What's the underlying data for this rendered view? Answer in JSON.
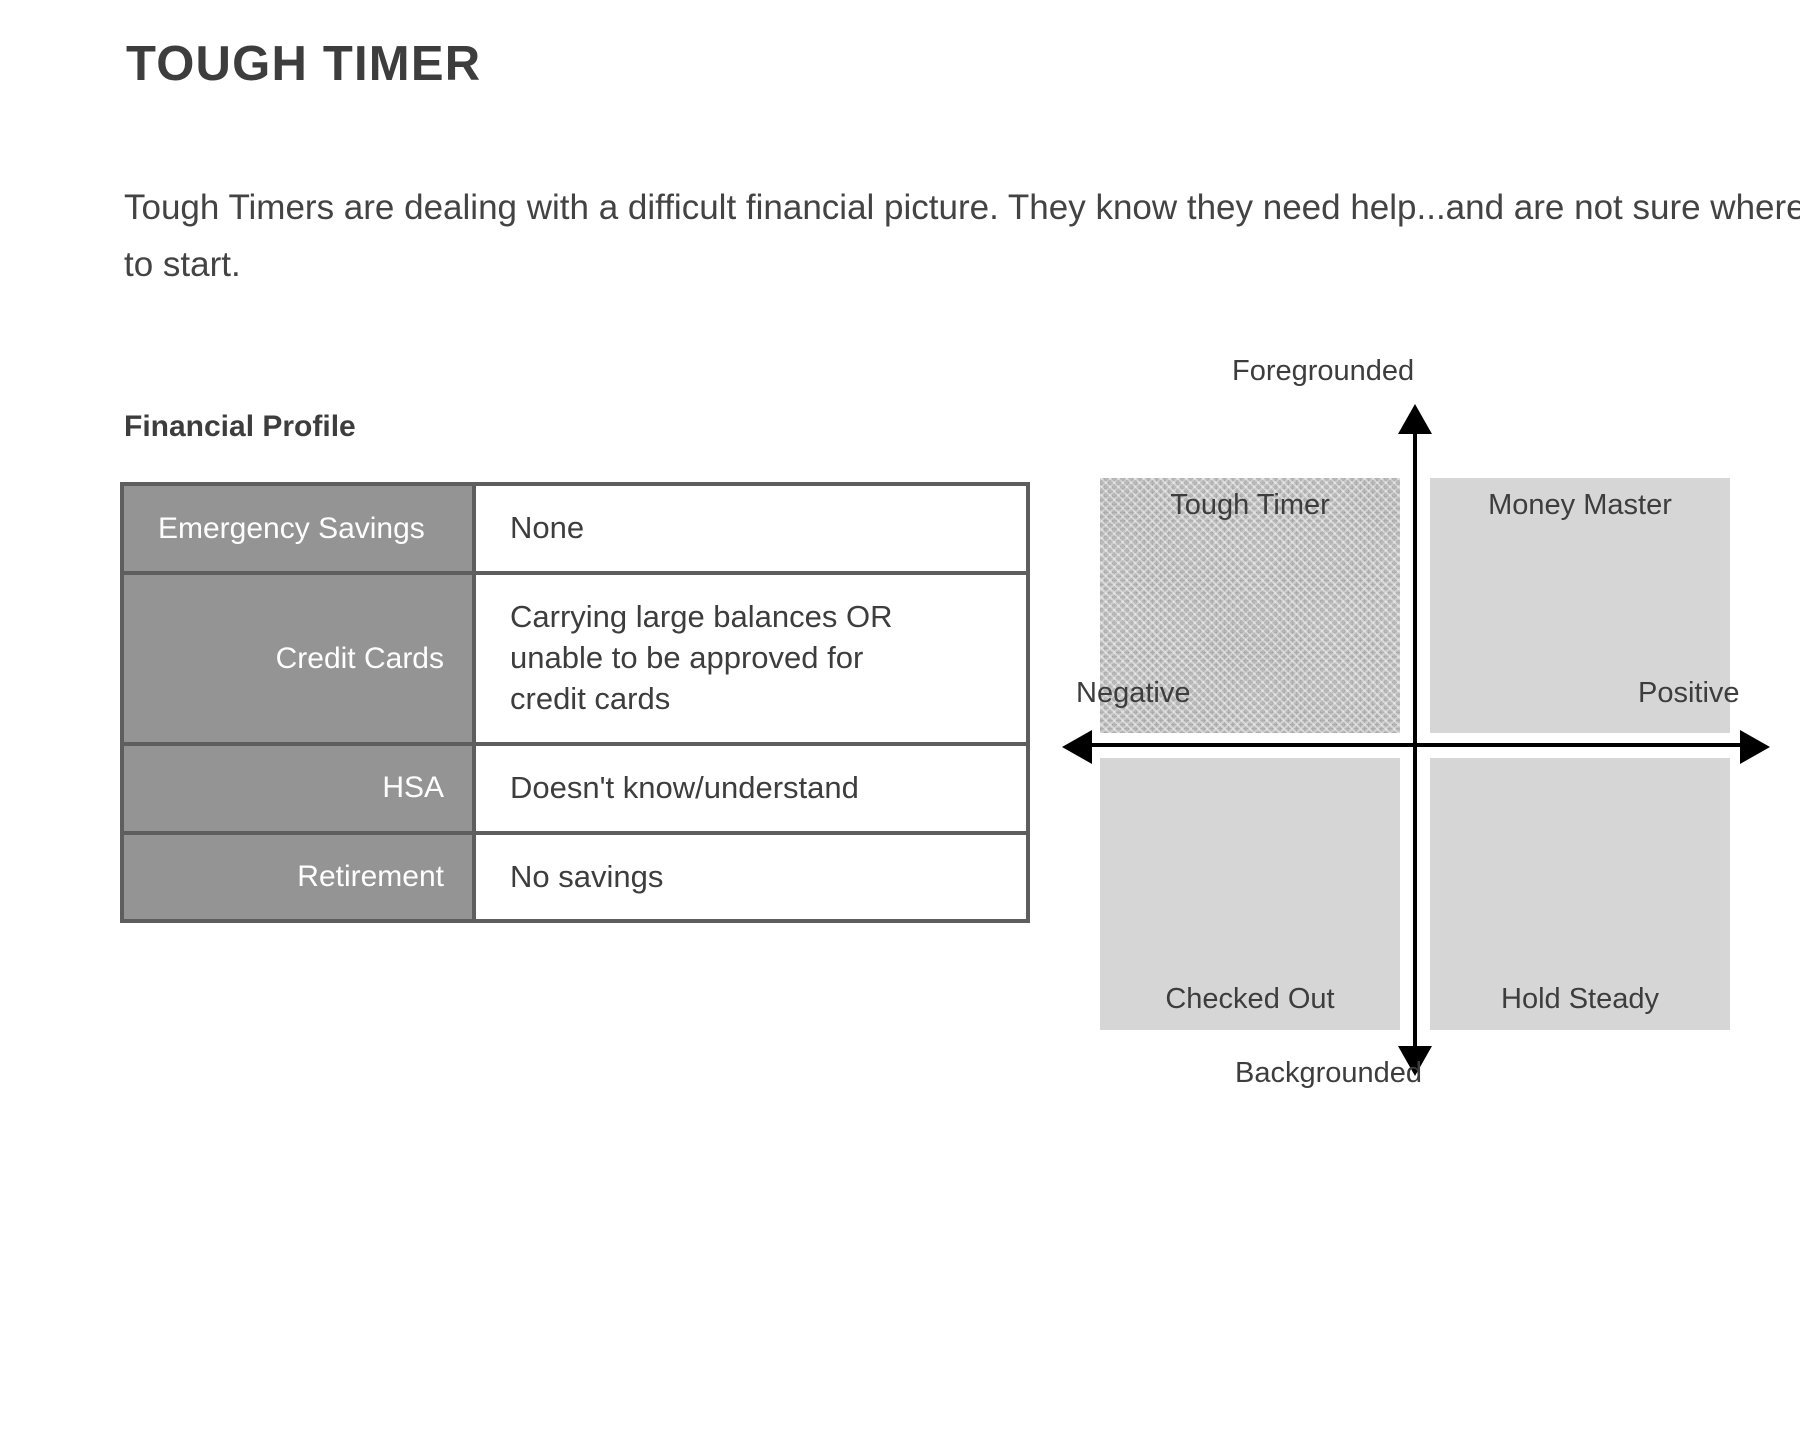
{
  "page": {
    "title": "TOUGH TIMER",
    "intro": "Tough Timers are dealing with a difficult financial picture. They know they need help...and are not sure where to start."
  },
  "financial_profile": {
    "heading": "Financial Profile",
    "rows": [
      {
        "label": "Emergency Savings",
        "value": "None"
      },
      {
        "label": "Credit Cards",
        "value_lines": [
          "Carrying large balances OR",
          "unable to be approved for",
          "credit cards"
        ]
      },
      {
        "label": "HSA",
        "value": "Doesn't know/understand"
      },
      {
        "label": "Retirement",
        "value": "No savings"
      }
    ]
  },
  "chart_data": {
    "type": "scatter",
    "title": "",
    "xlabel_negative": "Negative",
    "xlabel_positive": "Positive",
    "ylabel_top": "Foregrounded",
    "ylabel_bottom": "Backgrounded",
    "quadrants": [
      {
        "id": "top-left",
        "label": "Tough Timer",
        "x": "Negative",
        "y": "Foregrounded",
        "highlighted": true,
        "fill": "#b8b8b8"
      },
      {
        "id": "top-right",
        "label": "Money Master",
        "x": "Positive",
        "y": "Foregrounded",
        "highlighted": false,
        "fill": "#d6d6d6"
      },
      {
        "id": "bottom-left",
        "label": "Checked Out",
        "x": "Negative",
        "y": "Backgrounded",
        "highlighted": false,
        "fill": "#d6d6d6"
      },
      {
        "id": "bottom-right",
        "label": "Hold Steady",
        "x": "Positive",
        "y": "Backgrounded",
        "highlighted": false,
        "fill": "#d6d6d6"
      }
    ],
    "axis_color": "#000000",
    "grid": false,
    "legend": "none"
  },
  "colors": {
    "text": "#3d3d3d",
    "table_label_bg": "#949494",
    "table_border": "#5e5e5e",
    "quadrant_fill": "#d6d6d6",
    "quadrant_highlight": "#b8b8b8"
  }
}
